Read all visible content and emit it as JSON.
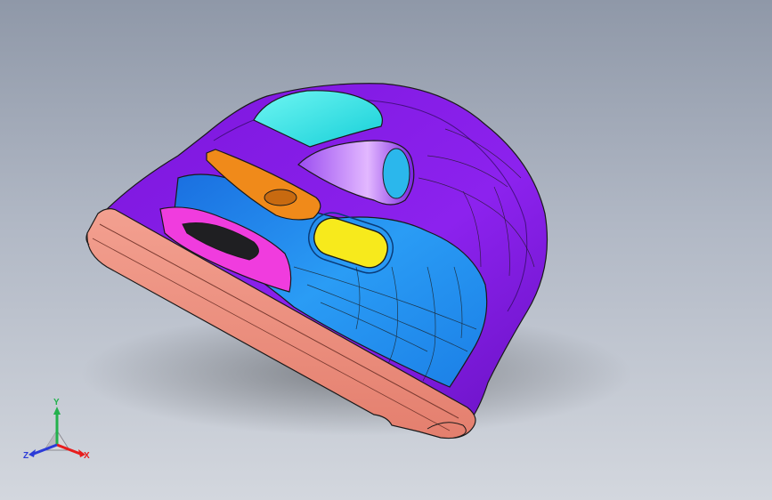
{
  "viewport": {
    "background_top": "#8f98a8",
    "background_bottom": "#d3d7de"
  },
  "model": {
    "description_icon": "door-trim-panel-model",
    "colors": {
      "frame_purple": "#8a1de6",
      "frame_purple_dark": "#5b0fb0",
      "upper_glass_cyan": "#2fe9e6",
      "armrest_blue": "#1f8fef",
      "handle_orange": "#f08a1a",
      "pocket_magenta": "#f03cde",
      "switch_yellow": "#f7ea1c",
      "base_salmon": "#f0907e",
      "edge_line": "#1a1a1a"
    }
  },
  "triad": {
    "y_label": "Y",
    "x_label": "X",
    "z_label": "Z",
    "y_color": "#22b14c",
    "x_color": "#e81c1c",
    "z_color": "#2b3bd8"
  }
}
